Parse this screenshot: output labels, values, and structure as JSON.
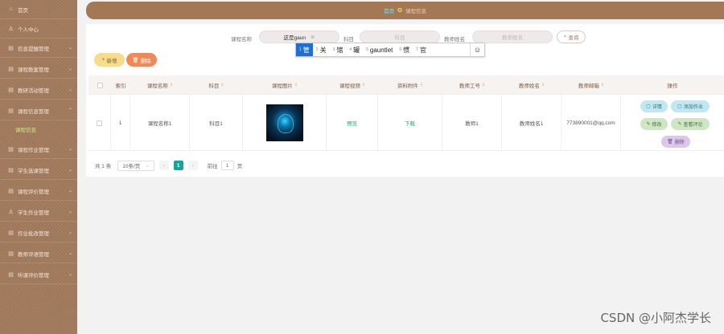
{
  "sidebar": {
    "items": [
      {
        "label": "首页"
      },
      {
        "label": "个人中心"
      },
      {
        "label": "信息提醒管理"
      },
      {
        "label": "课程教案管理"
      },
      {
        "label": "教研活动管理"
      },
      {
        "label": "课程信息管理"
      },
      {
        "label": "课程作业管理"
      },
      {
        "label": "学生选课管理"
      },
      {
        "label": "课程评价管理"
      },
      {
        "label": "学生作业管理"
      },
      {
        "label": "作业批改管理"
      },
      {
        "label": "教师评语管理"
      },
      {
        "label": "听课评价管理"
      }
    ],
    "active_sub": "课程信息"
  },
  "header": {
    "home": "首页",
    "current": "课程信息"
  },
  "search": {
    "course_name_label": "课程名称",
    "course_name_value": "这是gaun",
    "subject_label": "科目",
    "subject_placeholder": "科目",
    "teacher_name_label": "教师姓名",
    "teacher_name_placeholder": "教师姓名",
    "query_label": "查询"
  },
  "toolbar": {
    "add_label": "新增",
    "delete_label": "删除"
  },
  "ime": {
    "candidates": [
      {
        "n": "1",
        "text": "管"
      },
      {
        "n": "2",
        "text": "关"
      },
      {
        "n": "3",
        "text": "馆"
      },
      {
        "n": "4",
        "text": "罐"
      },
      {
        "n": "5",
        "text": "gauntlet"
      },
      {
        "n": "6",
        "text": "惯"
      },
      {
        "n": "7",
        "text": "官"
      }
    ],
    "emoji": "☺"
  },
  "table": {
    "headers": [
      "索引",
      "课程名称",
      "科目",
      "课程图片",
      "课程视频",
      "资料附件",
      "教师工号",
      "教师姓名",
      "教师邮箱",
      "操作"
    ],
    "row": {
      "index": "1",
      "course_name": "课程名称1",
      "subject": "科目1",
      "video": "预览",
      "attachment": "下载",
      "teacher_id": "教师1",
      "teacher_name": "教师姓名1",
      "email": "773890001@qq.com"
    },
    "actions": {
      "detail": "详情",
      "add_homework": "添加作业",
      "edit": "修改",
      "view_eval": "查看评论",
      "delete": "删除"
    }
  },
  "pagination": {
    "total": "共 1 条",
    "page_size": "10条/页",
    "current_page": "1",
    "goto_label": "前往",
    "goto_value": "1",
    "page_suffix": "页"
  },
  "watermark": "CSDN @小阿杰学长"
}
